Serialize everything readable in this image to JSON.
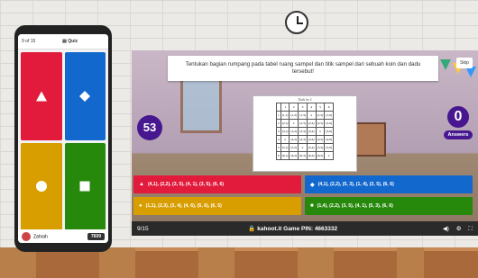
{
  "phone": {
    "progress": "9 of 15",
    "mode": "Quiz",
    "player_name": "Zahrah",
    "score": "7609",
    "tiles": [
      {
        "color": "#e21b3c",
        "icon": "triangle-icon"
      },
      {
        "color": "#1368ce",
        "icon": "diamond-icon"
      },
      {
        "color": "#d89e00",
        "icon": "circle-icon"
      },
      {
        "color": "#26890c",
        "icon": "square-icon"
      }
    ]
  },
  "question": {
    "text": "Tentukan bagian rumpang pada tabel ruang sampel dan titik sampel dari sebuah koin dan dadu tersebut!",
    "skip_label": "Skip",
    "timer": "53",
    "answers_count": "0",
    "answers_label": "Answers"
  },
  "image_table": {
    "caption": "Dadu ke-2",
    "side_label": "Dadu ke-1",
    "header": [
      "",
      "1",
      "2",
      "3",
      "4",
      "5",
      "6"
    ],
    "rows": [
      [
        "1",
        "(1,1)",
        "(1,2)",
        "(1,3)",
        "x",
        "(1,5)",
        "(1,6)"
      ],
      [
        "2",
        "(2,1)",
        "x",
        "(2,3)",
        "(2,4)",
        "(2,5)",
        "(2,6)"
      ],
      [
        "3",
        "(3,1)",
        "(3,2)",
        "(3,3)",
        "(3,4)",
        "x",
        "(3,6)"
      ],
      [
        "4",
        "x",
        "(4,2)",
        "(4,3)",
        "(4,4)",
        "(4,5)",
        "(4,6)"
      ],
      [
        "5",
        "(5,1)",
        "(5,2)",
        "x",
        "(5,4)",
        "(5,5)",
        "(5,6)"
      ],
      [
        "6",
        "(6,1)",
        "(6,2)",
        "(6,3)",
        "(6,4)",
        "(6,5)",
        "x"
      ]
    ]
  },
  "choices": [
    {
      "icon": "▲",
      "text": "(4,1), (2,2), (3, 5), (4, 1), (3, 5), (6, 6)",
      "color": "#e21b3c"
    },
    {
      "icon": "◆",
      "text": "(4,1), (2,2), (5, 3), (1, 4), (3, 5), (6, 6)",
      "color": "#1368ce"
    },
    {
      "icon": "●",
      "text": "(1,1), (2,3), (3, 4), (4, 6), (5, 6), (6, 5)",
      "color": "#d89e00"
    },
    {
      "icon": "■",
      "text": "(1,4), (2,2), (3, 5), (4, 1), (5, 3), (6, 6)",
      "color": "#26890c"
    }
  ],
  "footer": {
    "progress": "9/15",
    "game_pin": "kahoot.it Game PIN: 4663332"
  }
}
